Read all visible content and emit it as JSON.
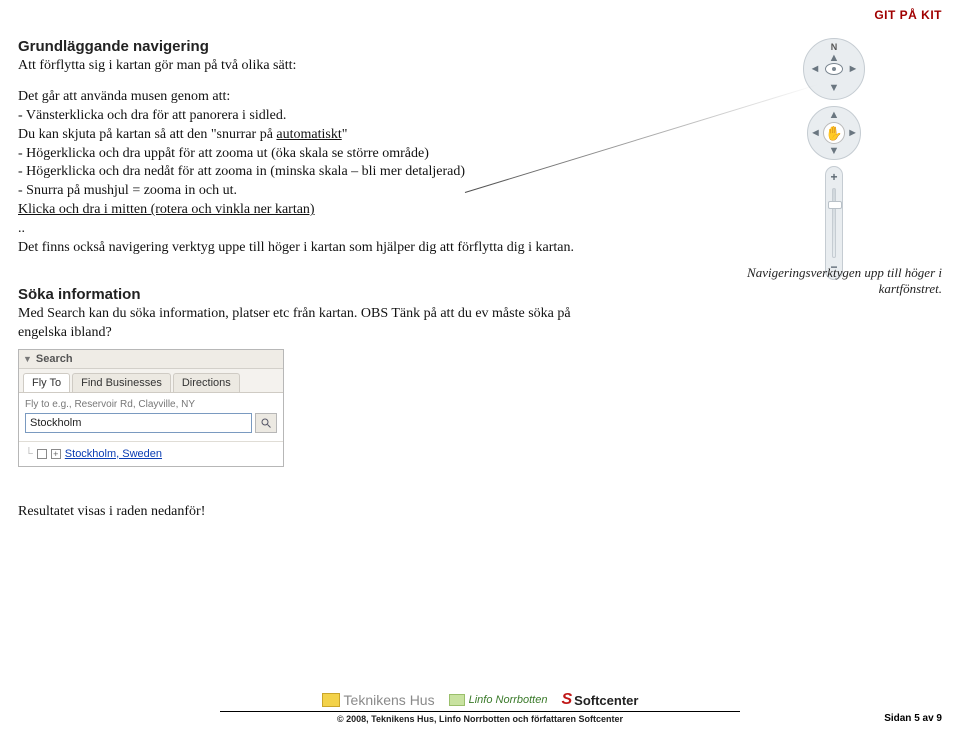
{
  "header": {
    "topRight": "GIT PÅ KIT"
  },
  "section1": {
    "title": "Grundläggande navigering",
    "intro": "Att förflytta sig i kartan gör man på två olika sätt:",
    "mouseLead": "Det går att använda musen genom att:",
    "bullets": {
      "b1": "- Vänsterklicka och dra för att panorera i sidled.",
      "b2a": "Du kan skjuta på kartan så att den \"snurrar på ",
      "b2b": "automatiskt",
      "b2c": "\"",
      "b3": "- Högerklicka och dra uppåt för att zooma ut (öka skala se större område)",
      "b4": "- Högerklicka och dra nedåt för att zooma in (minska skala – bli mer detaljerad)",
      "b5": "- Snurra på mushjul = zooma in och ut.",
      "b6": " Klicka och dra i mitten (rotera och vinkla ner kartan)",
      "dots": ".."
    },
    "toolsNote": "Det finns också navigering verktyg uppe till höger i kartan som hjälper dig att förflytta dig i kartan.",
    "caption": "Navigeringsverktygen upp till höger i kartfönstret."
  },
  "section2": {
    "title": "Söka information",
    "text": "Med Search kan du söka information, platser etc från kartan. OBS Tänk på att du ev måste söka på engelska ibland?"
  },
  "search": {
    "panelTitle": "Search",
    "tabs": {
      "flyto": "Fly To",
      "businesses": "Find Businesses",
      "directions": "Directions"
    },
    "label": "Fly to e.g., Reservoir Rd, Clayville, NY",
    "input": "Stockholm",
    "resultLink": "Stockholm, Sweden"
  },
  "resultNote": "Resultatet visas i raden nedanför!",
  "nav": {
    "north": "N",
    "plus": "+",
    "minus": "−"
  },
  "footer": {
    "logo1": "Teknikens Hus",
    "logo2": "Linfo Norrbotten",
    "logo3": "Softcenter",
    "copy": "© 2008, Teknikens Hus, Linfo Norrbotten och författaren Softcenter",
    "page": "Sidan 5 av 9"
  }
}
